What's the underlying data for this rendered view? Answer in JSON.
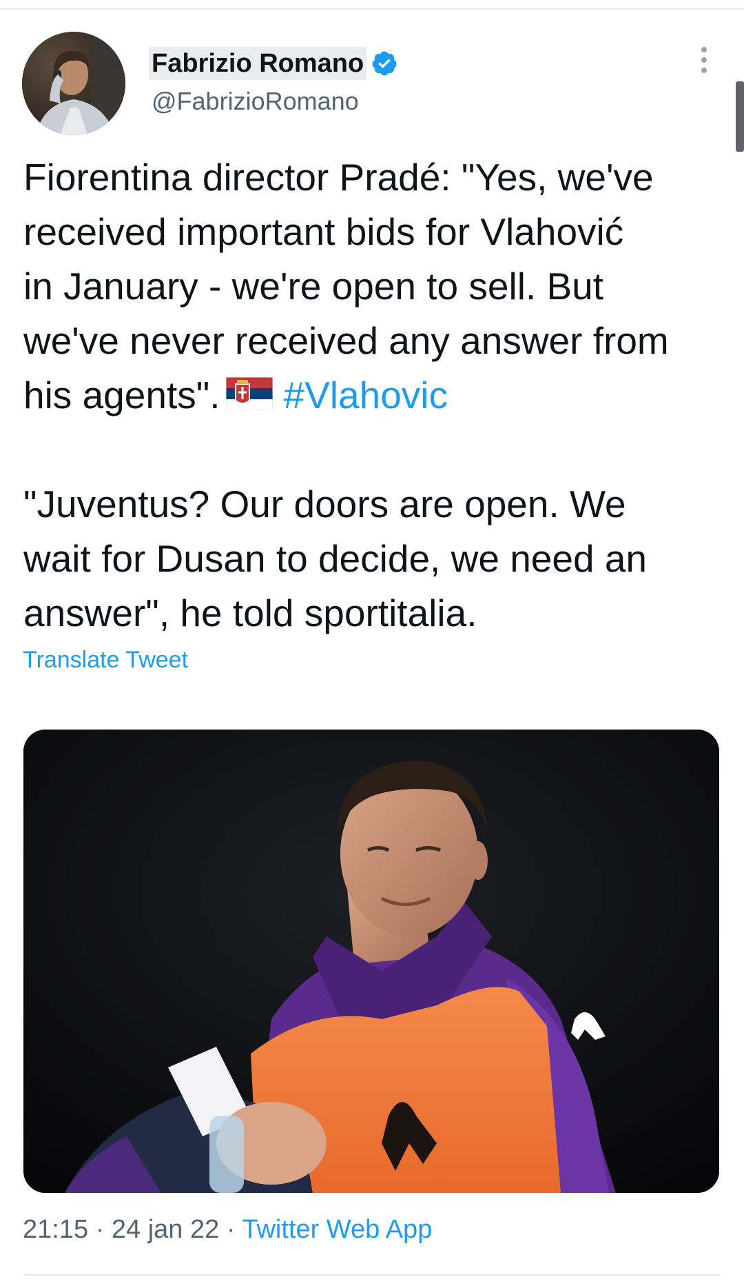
{
  "author": {
    "display_name": "Fabrizio Romano",
    "handle": "@FabrizioRomano",
    "verified": true,
    "avatar_icon": "profile-photo-man-on-phone"
  },
  "tweet": {
    "paragraph1_lines": [
      "Fiorentina director Pradé: \"Yes, we've",
      "received important bids for Vlahović",
      "in January - we're open to sell. But",
      "we've never received any answer from"
    ],
    "paragraph1_last_line": "his agents\".",
    "flag_emoji": "serbia-flag-icon",
    "hashtag": "#Vlahovic",
    "paragraph2_lines": [
      "\"Juventus? Our doors are open. We",
      "wait for Dusan to decide, we need an",
      "answer\", he told sportitalia."
    ],
    "translate_label": "Translate Tweet"
  },
  "media": {
    "icon": "photo-football-player-orange-bib"
  },
  "meta": {
    "time": "21:15",
    "separator": " · ",
    "date": "24 jan 22",
    "source": "Twitter Web App"
  },
  "colors": {
    "link_blue": "#1d9bf0",
    "text": "#0f1419",
    "secondary": "#536471"
  }
}
